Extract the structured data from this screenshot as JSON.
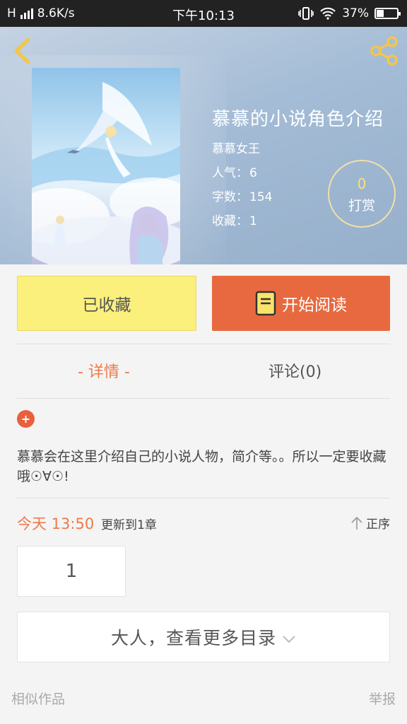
{
  "status_bar": {
    "network": "H",
    "speed": "8.6K/s",
    "time": "下午10:13",
    "battery": "37%",
    "battery_level": 0.37
  },
  "book": {
    "title": "慕慕的小说角色介绍",
    "author": "慕慕女王",
    "popularity_label": "人气：",
    "popularity_value": "6",
    "words_label": "字数：",
    "words_value": "154",
    "favorites_label": "收藏：",
    "favorites_value": "1"
  },
  "reward": {
    "count": "0",
    "label": "打赏"
  },
  "actions": {
    "favorited_label": "已收藏",
    "read_label": "开始阅读"
  },
  "tabs": [
    {
      "label": "- 详情 -",
      "active": true
    },
    {
      "label": "评论(0)",
      "active": false
    }
  ],
  "description": {
    "badge": "+",
    "text": "慕慕会在这里介绍自己的小说人物，简介等。。所以一定要收藏哦☉∀☉!"
  },
  "updates": {
    "time": "今天 13:50",
    "text": "更新到1章",
    "sort_label": "正序"
  },
  "chapters": [
    "1"
  ],
  "more_catalog_label": "大人，查看更多目录",
  "footer": {
    "similar_label": "相似作品",
    "report_label": "举报"
  },
  "colors": {
    "accent_orange": "#e8693f",
    "favorite_yellow": "#fbf07b",
    "reward_number": "#f6e27a"
  }
}
